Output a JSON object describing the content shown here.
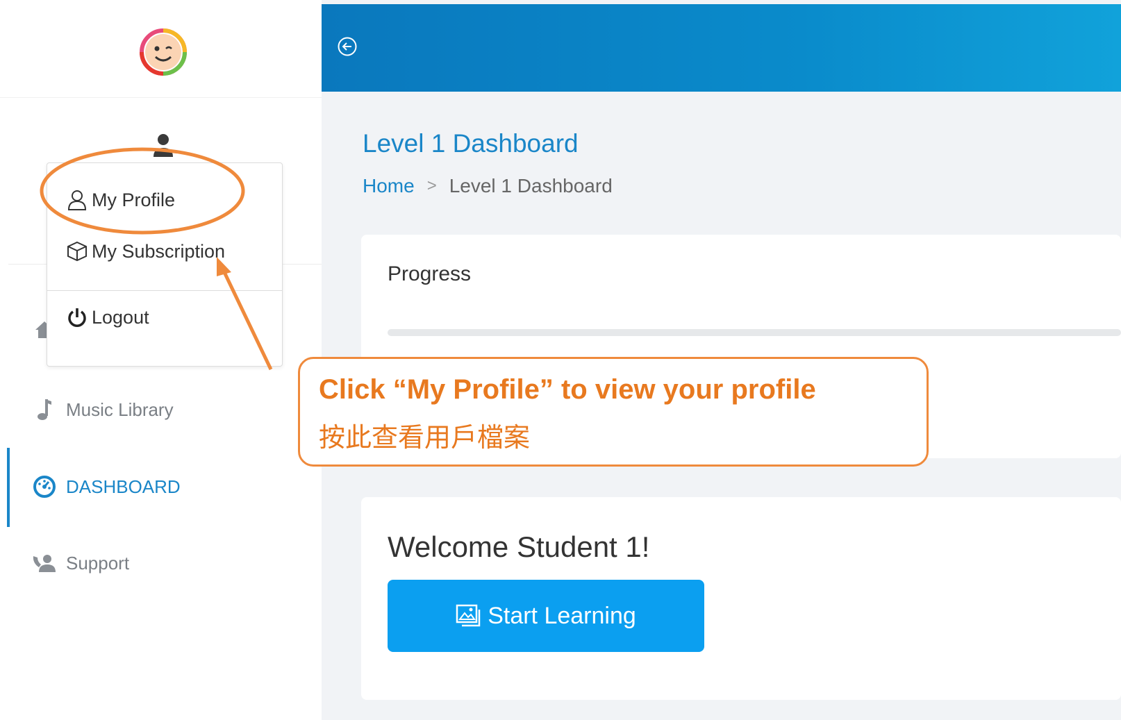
{
  "sidebar": {
    "logo_icon": "smiley-logo-icon",
    "user_icon": "user-icon",
    "dropdown": {
      "items": [
        {
          "label": "My Profile",
          "icon": "user-outline-icon"
        },
        {
          "label": "My Subscription",
          "icon": "box-icon"
        },
        {
          "label": "Logout",
          "icon": "power-icon"
        }
      ]
    },
    "nav": [
      {
        "label": "Music Library",
        "icon": "music-note-icon",
        "active": false
      },
      {
        "label": "DASHBOARD",
        "icon": "dashboard-gauge-icon",
        "active": true
      },
      {
        "label": "Support",
        "icon": "support-icon",
        "active": false
      }
    ]
  },
  "topbar": {
    "back_icon": "circle-arrow-left-icon"
  },
  "main": {
    "page_title": "Level 1 Dashboard",
    "breadcrumb": {
      "home": "Home",
      "separator": ">",
      "current": "Level 1 Dashboard"
    },
    "progress_card": {
      "title": "Progress",
      "progress_value": 0
    },
    "welcome_card": {
      "welcome_text": "Welcome Student 1!",
      "start_button": "Start Learning",
      "start_button_icon": "image-gallery-icon"
    }
  },
  "annotation": {
    "callout_line1": "Click “My Profile” to view your profile",
    "callout_line2": "按此查看用戶檔案",
    "color": "#ef8a3c"
  },
  "colors": {
    "accent": "#1a86c8",
    "button": "#0b9ff0",
    "topbar_start": "#0a78bd",
    "topbar_end": "#11a2da"
  }
}
